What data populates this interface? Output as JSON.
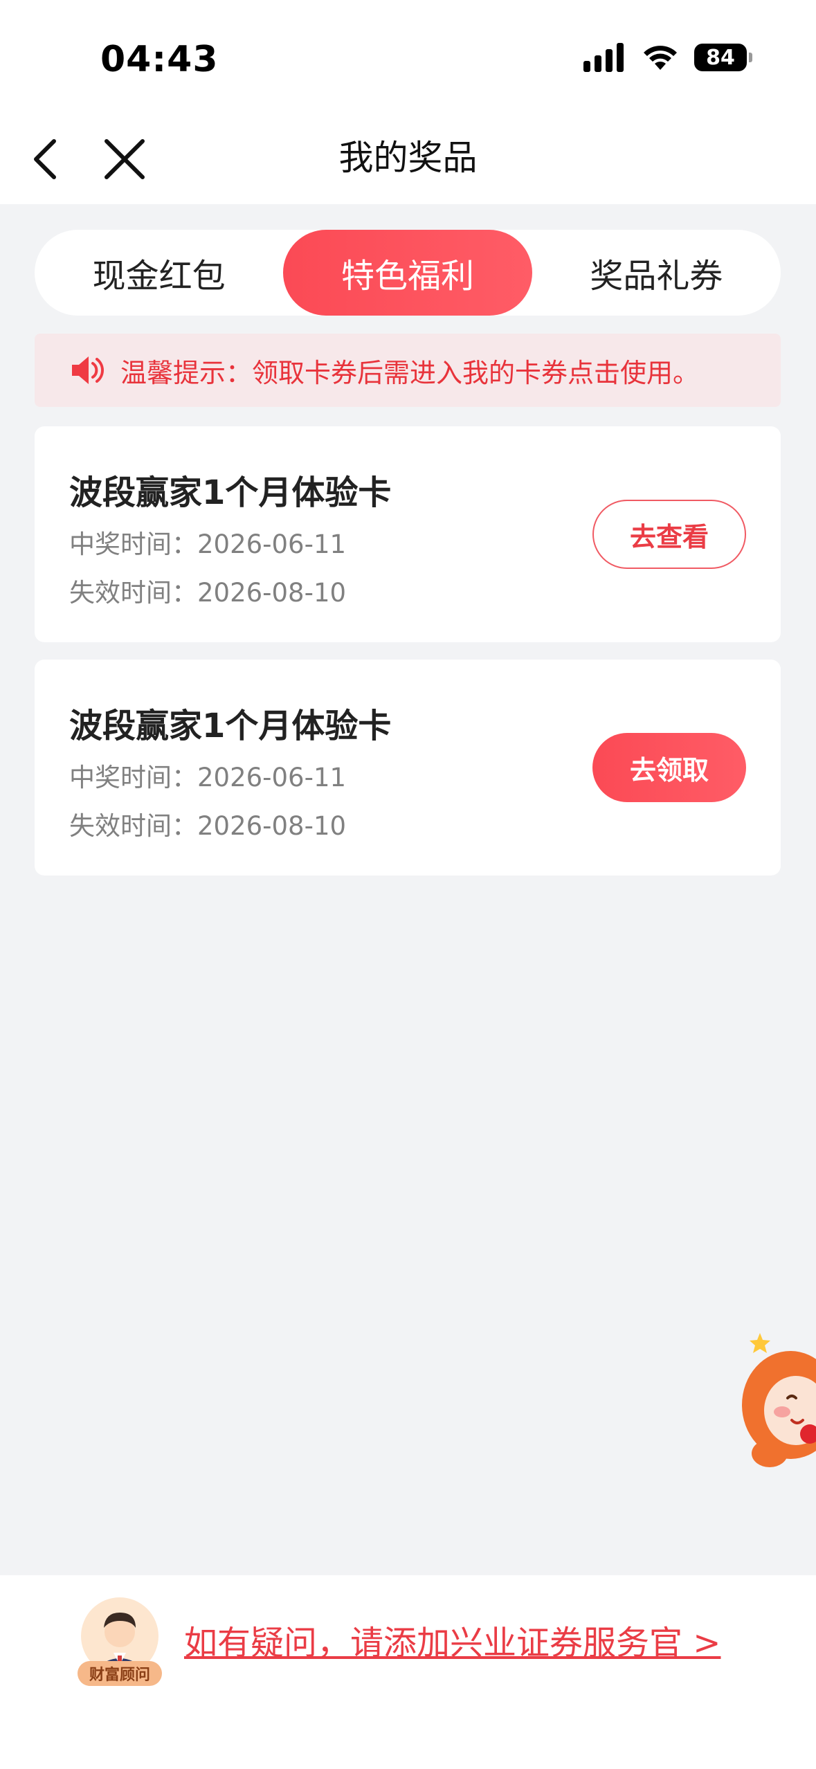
{
  "status_bar": {
    "time": "04:43",
    "battery": "84"
  },
  "nav": {
    "title": "我的奖品"
  },
  "tabs": [
    {
      "label": "现金红包",
      "active": false
    },
    {
      "label": "特色福利",
      "active": true
    },
    {
      "label": "奖品礼券",
      "active": false
    }
  ],
  "notice": {
    "text": "温馨提示：领取卡券后需进入我的卡券点击使用。"
  },
  "prizes": [
    {
      "title": "波段赢家1个月体验卡",
      "win_time": "中奖时间：2026-06-11",
      "expire_time": "失效时间：2026-08-10",
      "button": "去查看"
    },
    {
      "title": "波段赢家1个月体验卡",
      "win_time": "中奖时间：2026-06-11",
      "expire_time": "失效时间：2026-08-10",
      "button": "去领取"
    }
  ],
  "footer": {
    "advisor_badge": "财富顾问",
    "help_link": "如有疑问，请添加兴业证券服务官 >"
  },
  "colors": {
    "accent": "#fb4a55",
    "background": "#f2f3f5",
    "notice_bg": "#f7e8ea"
  },
  "icons": {
    "back": "chevron-left-icon",
    "close": "close-icon",
    "notice": "speaker-icon",
    "signal": "signal-icon",
    "wifi": "wifi-icon"
  }
}
